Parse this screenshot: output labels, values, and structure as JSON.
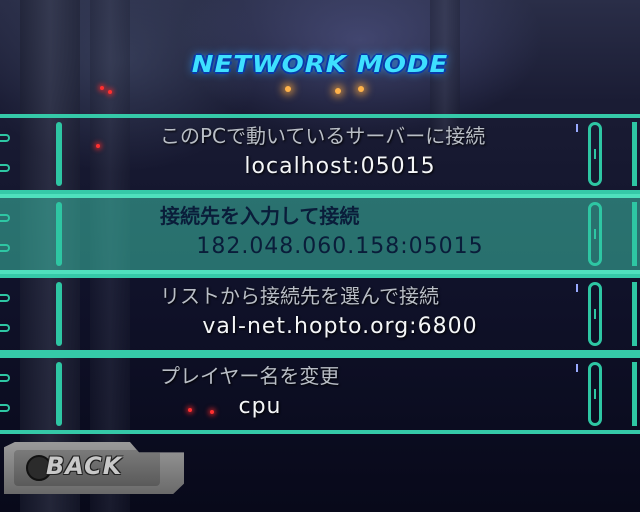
{
  "screen": {
    "title": "NETWORK MODE",
    "selected_index": 1
  },
  "menu": {
    "items": [
      {
        "label": "このPCで動いているサーバーに接続",
        "value": "localhost:05015"
      },
      {
        "label": "接続先を入力して接続",
        "value": "182.048.060.158:05015"
      },
      {
        "label": "リストから接続先を選んで接続",
        "value": "val-net.hopto.org:6800"
      },
      {
        "label": "プレイヤー名を変更",
        "value": "cpu"
      }
    ]
  },
  "back_button": {
    "label": "BACK",
    "icon": "gamepad-button-icon"
  },
  "colors": {
    "frame": "#35c9a8",
    "selected_fill": "#3cbea5",
    "title": "#3ee0ff",
    "value_text": "#f4f6f8"
  }
}
